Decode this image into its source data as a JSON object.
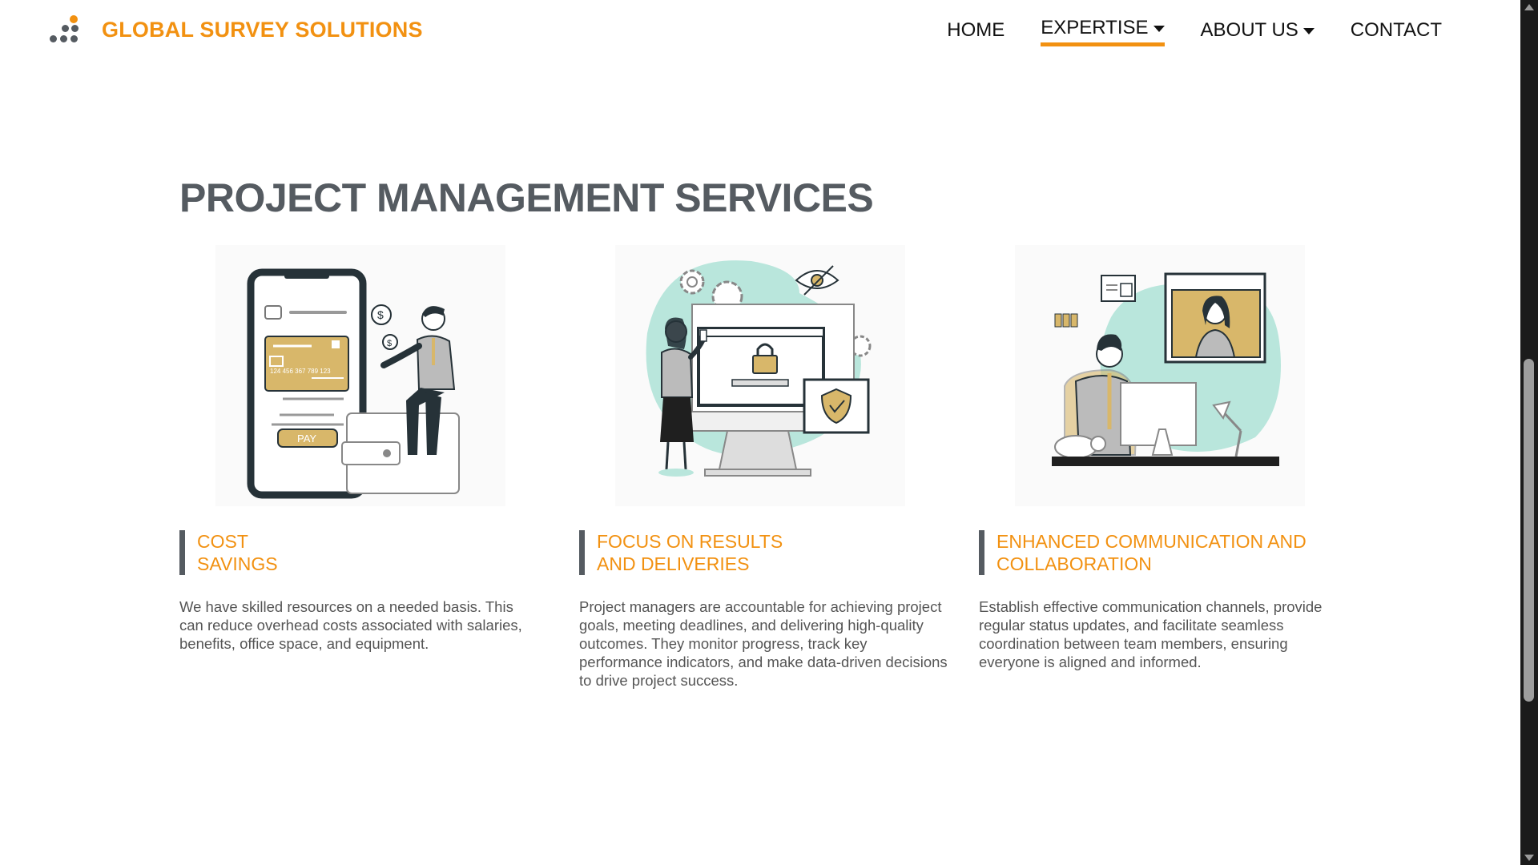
{
  "header": {
    "brand": "GLOBAL SURVEY SOLUTIONS",
    "nav": [
      {
        "label": "HOME"
      },
      {
        "label": "EXPERTISE"
      },
      {
        "label": "ABOUT US"
      },
      {
        "label": "CONTACT"
      }
    ]
  },
  "main": {
    "title": "PROJECT MANAGEMENT SERVICES",
    "cards": [
      {
        "heading_line1": "COST",
        "heading_line2": "SAVINGS",
        "body": "We have skilled resources on a needed basis. This can reduce overhead costs associated with salaries, benefits, office space, and equipment.",
        "illustration": {
          "card_number": "124 456 367 789 123",
          "pay_label": "PAY"
        }
      },
      {
        "heading_line1": "FOCUS ON RESULTS",
        "heading_line2": "AND DELIVERIES",
        "body": "Project managers are accountable for achieving project goals, meeting deadlines, and delivering high-quality outcomes. They monitor progress, track key performance indicators, and make data-driven decisions to drive project success."
      },
      {
        "heading_line1": "ENHANCED COMMUNICATION AND",
        "heading_line2": "COLLABORATION",
        "body": "Establish effective communication channels, provide regular status updates, and facilitate seamless coordination between team members, ensuring everyone is aligned and informed."
      }
    ]
  },
  "colors": {
    "accent": "#f29111",
    "title": "#555b61",
    "mint": "#b9e6dc",
    "gold": "#d8b76a"
  },
  "icons": [
    "logo-dots-icon",
    "caret-down-icon"
  ]
}
